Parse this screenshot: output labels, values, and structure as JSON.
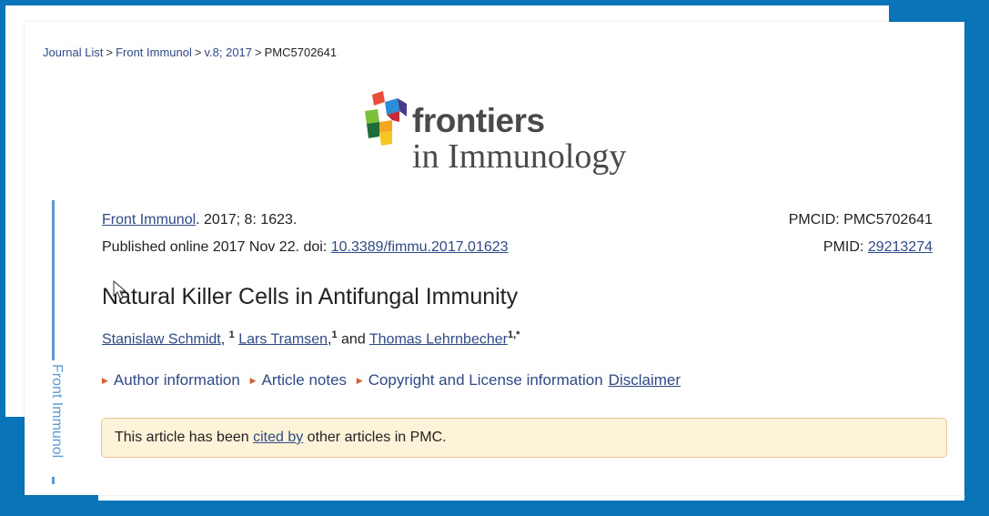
{
  "breadcrumb": {
    "items": [
      "Journal List",
      "Front Immunol",
      "v.8; 2017"
    ],
    "current": "PMC5702641"
  },
  "logo": {
    "word1": "frontiers",
    "word2": "in Immunology",
    "colors": [
      "#e94e3a",
      "#f6a623",
      "#2a8fd6",
      "#7bbf3b",
      "#4a3b8c",
      "#c12b3a"
    ]
  },
  "sidebar": {
    "label": "Front Immunol"
  },
  "citation": {
    "journal": "Front Immunol",
    "details": ". 2017; 8: 1623.",
    "published_prefix": "Published online 2017 Nov 22. doi: ",
    "doi": "10.3389/fimmu.2017.01623",
    "pmcid_label": "PMCID: PMC5702641",
    "pmid_label": "PMID: ",
    "pmid": "29213274"
  },
  "article": {
    "title": "Natural Killer Cells in Antifungal Immunity",
    "authors": [
      {
        "name": "Stanislaw Schmidt",
        "sup": "1",
        "after": ", "
      },
      {
        "name": "Lars Tramsen",
        "sup": "1",
        "after": " and "
      },
      {
        "name": "Thomas Lehrnbecher",
        "sup": "1,*",
        "after": ""
      }
    ]
  },
  "article_links": {
    "author_info": "Author information",
    "article_notes": "Article notes",
    "copyright": "Copyright and License information",
    "disclaimer": "Disclaimer"
  },
  "notice": {
    "prefix": "This article has been ",
    "link": "cited by",
    "suffix": " other articles in PMC."
  },
  "theme": {
    "link": "#2f4a86",
    "sidebar": "#5a9ad5",
    "background": "#0a74b8"
  }
}
